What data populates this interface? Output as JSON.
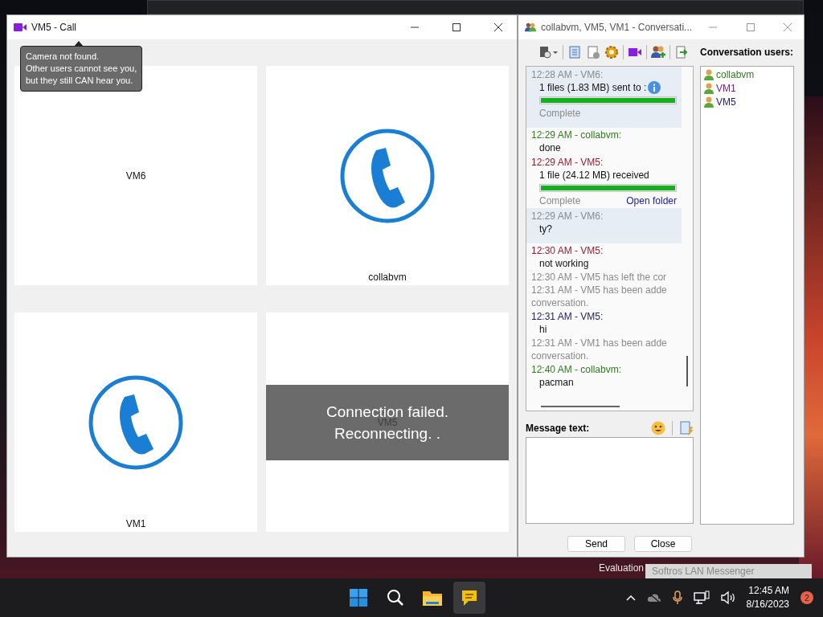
{
  "call_window": {
    "title": "VM5 - Call",
    "tooltip": "Camera not found.\nOther users cannot see you,\nbut they still CAN hear you.",
    "tiles": [
      {
        "kind": "blank",
        "label": "VM6"
      },
      {
        "kind": "phone",
        "label": "collabvm"
      },
      {
        "kind": "phone",
        "label": "VM1"
      },
      {
        "kind": "reconnecting",
        "label": "VM5",
        "overlay": "Connection failed.\nReconnecting. ."
      }
    ]
  },
  "conversation_window": {
    "title": "collabvm, VM5, VM1 - Conversati...",
    "users_heading": "Conversation users:",
    "users": [
      {
        "name": "collabvm",
        "color": "#2e7d1e"
      },
      {
        "name": "VM1",
        "color": "#7a1f8a"
      },
      {
        "name": "VM5",
        "color": "#24206e"
      }
    ],
    "messages": [
      {
        "kind": "file",
        "header": "12:28 AM - VM6:",
        "color": "#8a8a8a",
        "highlighted": true,
        "text": "1 files (1.83 MB) sent to :",
        "level": 1,
        "status": "Complete"
      },
      {
        "kind": "message",
        "header": "12:29 AM - collabvm:",
        "color": "#2e7d1e",
        "highlighted": false,
        "text": "done"
      },
      {
        "kind": "file",
        "header": "12:29 AM - VM5:",
        "color": "#9b1c2c",
        "highlighted": false,
        "text": "1 file (24.12 MB) received",
        "level": 1,
        "status": "Complete",
        "link": "Open folder"
      },
      {
        "kind": "message",
        "header": "12:29 AM - VM6:",
        "color": "#8a8a8a",
        "highlighted": true,
        "text": "ty?"
      },
      {
        "kind": "message",
        "header": "12:30 AM - VM5:",
        "color": "#9b1c2c",
        "highlighted": false,
        "text": "not working"
      },
      {
        "kind": "system",
        "text": "12:30 AM - VM5 has left the cor"
      },
      {
        "kind": "system",
        "text": "12:31 AM - VM5 has been adde\nconversation."
      },
      {
        "kind": "message",
        "header": "12:31 AM - VM5:",
        "color": "#24206e",
        "highlighted": false,
        "text": "hi"
      },
      {
        "kind": "system",
        "text": "12:31 AM - VM1 has been adde\nconversation."
      },
      {
        "kind": "message",
        "header": "12:40 AM - collabvm:",
        "color": "#2e7d1e",
        "highlighted": false,
        "text": "pacman"
      }
    ],
    "message_label": "Message text:",
    "buttons": [
      "Send",
      "Close"
    ]
  },
  "desktop": {
    "watermark": "Evaluation",
    "notification": "Softros LAN Messenger"
  },
  "taskbar": {
    "apps": [
      {
        "kind": "start",
        "selected": false
      },
      {
        "kind": "search",
        "selected": false
      },
      {
        "kind": "files",
        "selected": false
      },
      {
        "kind": "messenger",
        "selected": true
      }
    ],
    "time": "12:45 AM",
    "date": "8/16/2023",
    "badge": "2"
  }
}
